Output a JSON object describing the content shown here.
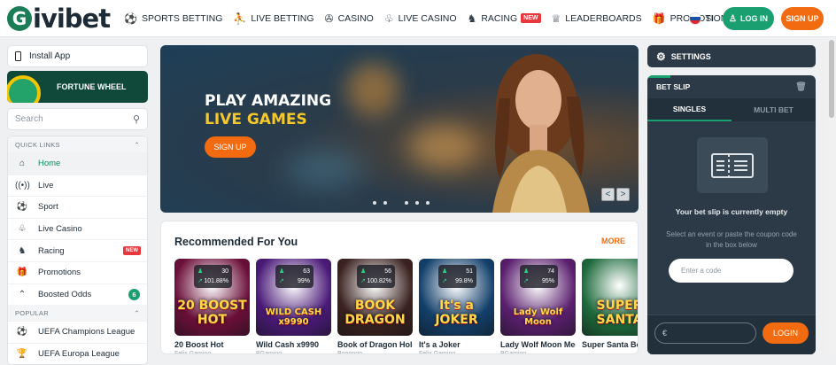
{
  "brand": {
    "logo_mark": "G",
    "logo_text": "ivibet"
  },
  "nav": [
    {
      "icon": "⚽",
      "icon_name": "soccer-ball-icon",
      "label": "SPORTS BETTING"
    },
    {
      "icon": "⛹",
      "icon_name": "live-betting-icon",
      "label": "LIVE BETTING"
    },
    {
      "icon": "✇",
      "icon_name": "casino-chip-icon",
      "label": "CASINO"
    },
    {
      "icon": "♧",
      "icon_name": "live-casino-icon",
      "label": "LIVE CASINO"
    },
    {
      "icon": "♞",
      "icon_name": "horse-icon",
      "label": "RACING",
      "badge": "NEW"
    },
    {
      "icon": "♕",
      "icon_name": "leaderboard-icon",
      "label": "LEADERBOARDS"
    },
    {
      "icon": "🎁",
      "icon_name": "gift-icon",
      "label": "PROMOTIONS"
    }
  ],
  "nav_more": "•••",
  "header": {
    "lang": "SI",
    "login": "LOG IN",
    "signup": "SIGN UP"
  },
  "sidebar": {
    "install": "Install App",
    "fortune_wheel": "FORTUNE WHEEL",
    "search_placeholder": "Search",
    "quick_links_title": "QUICK LINKS",
    "quick_links": [
      {
        "label": "Home",
        "icon": "⌂",
        "icon_name": "home-icon",
        "active": true
      },
      {
        "label": "Live",
        "icon": "((•))",
        "icon_name": "live-signal-icon"
      },
      {
        "label": "Sport",
        "icon": "⚽",
        "icon_name": "soccer-ball-icon"
      },
      {
        "label": "Live Casino",
        "icon": "♧",
        "icon_name": "live-casino-icon"
      },
      {
        "label": "Racing",
        "icon": "♞",
        "icon_name": "horse-icon",
        "badge": "NEW"
      },
      {
        "label": "Promotions",
        "icon": "🎁",
        "icon_name": "gift-icon"
      },
      {
        "label": "Boosted Odds",
        "icon": "⌃",
        "icon_name": "boost-arrows-icon",
        "count": "6"
      }
    ],
    "popular_title": "POPULAR",
    "popular": [
      {
        "label": "UEFA Champions League",
        "icon": "⚽",
        "icon_name": "champions-league-icon"
      },
      {
        "label": "UEFA Europa League",
        "icon": "🏆",
        "icon_name": "europa-league-icon"
      }
    ]
  },
  "hero": {
    "line1": "PLAY AMAZING",
    "line2": "LIVE GAMES",
    "button": "SIGN UP",
    "prev": "<",
    "next": ">"
  },
  "recommended": {
    "title": "Recommended For You",
    "more": "MORE",
    "games": [
      {
        "name": "20 Boost Hot",
        "provider": "Felix Gaming",
        "players": "30",
        "rtp": "101.88%",
        "thumb_text": "20 BOOST HOT",
        "bg": "#6b0f3a"
      },
      {
        "name": "Wild Cash x9990",
        "provider": "BGaming",
        "players": "63",
        "rtp": "99%",
        "thumb_text": "WILD CASH x9990",
        "bg": "#4a1a78"
      },
      {
        "name": "Book of Dragon Hold And Win",
        "provider": "Booongo",
        "players": "56",
        "rtp": "100.82%",
        "thumb_text": "BOOK DRAGON",
        "bg": "#3a2220"
      },
      {
        "name": "It's a Joker",
        "provider": "Felix Gaming",
        "players": "51",
        "rtp": "99.8%",
        "thumb_text": "It's a JOKER",
        "bg": "#13406b"
      },
      {
        "name": "Lady Wolf Moon Megaways",
        "provider": "BGaming",
        "players": "74",
        "rtp": "95%",
        "thumb_text": "Lady Wolf Moon",
        "bg": "#5a1f6e"
      },
      {
        "name": "Super Santa Bonanza Win",
        "provider": "",
        "players": "",
        "rtp": "",
        "thumb_text": "SUPER SANTA",
        "bg": "#1d6a3c"
      }
    ]
  },
  "settings": {
    "label": "SETTINGS"
  },
  "betslip": {
    "title": "BET SLIP",
    "tab_singles": "SINGLES",
    "tab_multi": "MULTI BET",
    "empty_title": "Your bet slip is currently empty",
    "empty_text": "Select an event or paste the coupon code in the box below",
    "code_placeholder": "Enter a code",
    "currency": "€",
    "login": "LOGIN"
  }
}
